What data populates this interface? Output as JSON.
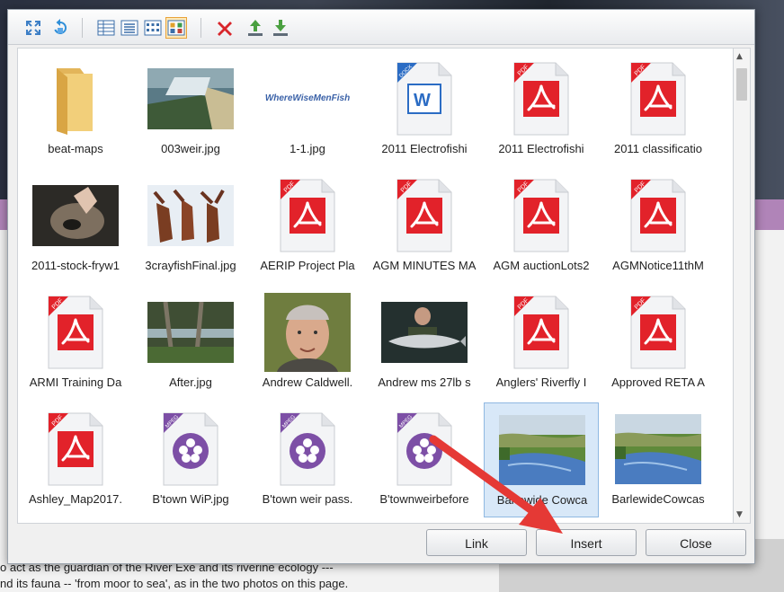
{
  "background": {
    "line1": "o act as the guardian of the River Exe and its riverine ecology ---",
    "line2": "nd its fauna -- 'from moor to sea', as in the two photos on this page."
  },
  "toolbar": {
    "buttons": [
      {
        "name": "expand-icon"
      },
      {
        "name": "refresh-icon"
      },
      {
        "name": "view-details-icon"
      },
      {
        "name": "view-list-icon"
      },
      {
        "name": "view-small-icons-icon"
      },
      {
        "name": "view-large-icons-icon",
        "active": true
      },
      {
        "name": "delete-icon"
      },
      {
        "name": "upload-icon"
      },
      {
        "name": "download-icon"
      }
    ]
  },
  "files": [
    {
      "label": "beat-maps",
      "kind": "folder"
    },
    {
      "label": "003weir.jpg",
      "kind": "photo-weir"
    },
    {
      "label": "1-1.jpg",
      "kind": "logo",
      "logo_text": "WhereWiseMenFish"
    },
    {
      "label": "2011 Electrofishi",
      "kind": "docx",
      "tag": "DOCX"
    },
    {
      "label": "2011 Electrofishi",
      "kind": "pdf",
      "tag": "PDF"
    },
    {
      "label": "2011 classificatio",
      "kind": "pdf",
      "tag": "PDF"
    },
    {
      "label": "2011-stock-fryw1",
      "kind": "photo-hands"
    },
    {
      "label": "3crayfishFinal.jpg",
      "kind": "photo-crayfish"
    },
    {
      "label": "AERIP Project Pla",
      "kind": "pdf",
      "tag": "PDF"
    },
    {
      "label": "AGM MINUTES MA",
      "kind": "pdf",
      "tag": "PDF"
    },
    {
      "label": "AGM auctionLots2",
      "kind": "pdf",
      "tag": "PDF"
    },
    {
      "label": "AGMNotice11thM",
      "kind": "pdf",
      "tag": "PDF"
    },
    {
      "label": "ARMI Training Da",
      "kind": "pdf",
      "tag": "PDF"
    },
    {
      "label": "After.jpg",
      "kind": "photo-stream"
    },
    {
      "label": "Andrew Caldwell.",
      "kind": "photo-portrait"
    },
    {
      "label": "Andrew ms 27lb s",
      "kind": "photo-salmon"
    },
    {
      "label": "Anglers' Riverfly I",
      "kind": "pdf",
      "tag": "PDF"
    },
    {
      "label": "Approved RETA A",
      "kind": "pdf",
      "tag": "PDF"
    },
    {
      "label": "Ashley_Map2017.",
      "kind": "pdf",
      "tag": "PDF"
    },
    {
      "label": "B'town WiP.jpg",
      "kind": "mpeg",
      "tag": "MPEG"
    },
    {
      "label": "B'town weir pass.",
      "kind": "mpeg",
      "tag": "MPEG"
    },
    {
      "label": "B'townweirbefore",
      "kind": "mpeg",
      "tag": "MPEG"
    },
    {
      "label": "Barlewide Cowca",
      "kind": "photo-river",
      "selected": true
    },
    {
      "label": "BarlewideCowcas",
      "kind": "photo-river"
    }
  ],
  "buttons": {
    "link": "Link",
    "insert": "Insert",
    "close": "Close"
  },
  "colors": {
    "pdf_red": "#e2222a",
    "mpeg_purple": "#7d4fa6",
    "docx_blue": "#2b6cc4",
    "arrow_red": "#e53935",
    "selection": "#d8e8f8"
  }
}
